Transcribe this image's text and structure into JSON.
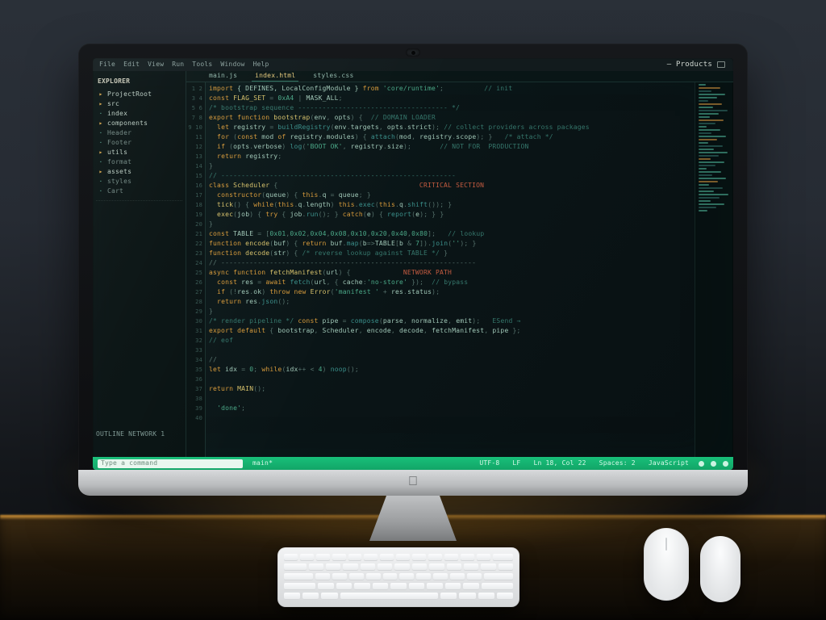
{
  "menubar": [
    "File",
    "Edit",
    "View",
    "Run",
    "Tools",
    "Window",
    "Help"
  ],
  "topRight": {
    "label": "Products"
  },
  "sidebar": {
    "head": "EXPLORER",
    "items": [
      {
        "t": "ProjectRoot",
        "fold": true
      },
      {
        "t": "src",
        "fold": true
      },
      {
        "t": "index",
        "fold": false
      },
      {
        "t": "components",
        "fold": true
      },
      {
        "t": "Header",
        "dim": true
      },
      {
        "t": "Footer",
        "dim": true
      },
      {
        "t": "utils",
        "fold": true
      },
      {
        "t": "format",
        "dim": true
      },
      {
        "t": "assets",
        "fold": true
      },
      {
        "t": "styles",
        "dim": true
      },
      {
        "t": "Cart",
        "dim": true
      }
    ],
    "foot": "OUTLINE  NETWORK 1"
  },
  "tabs": [
    {
      "label": "main.js",
      "active": false
    },
    {
      "label": "index.html",
      "active": true
    },
    {
      "label": "styles.css",
      "active": false
    }
  ],
  "gutterStart": 1,
  "gutterCount": 40,
  "statusbar": {
    "placeholder": "Type a command",
    "seg1": "main*",
    "seg2": "UTF-8",
    "seg3": "LF",
    "seg4": "Ln 18, Col 22",
    "seg5": "Spaces: 2",
    "seg6": "JavaScript"
  }
}
